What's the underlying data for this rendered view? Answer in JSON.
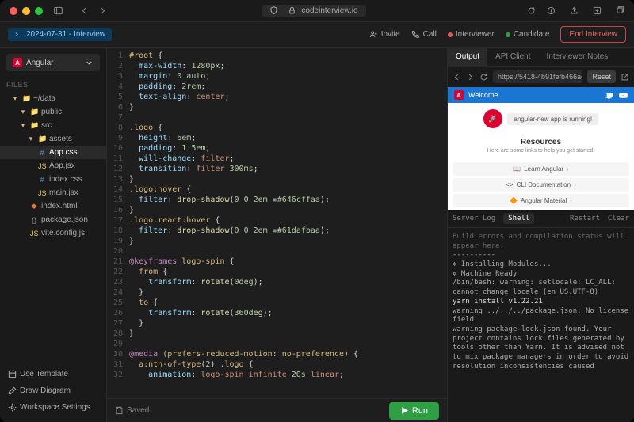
{
  "browser": {
    "url_display": "codeinterview.io"
  },
  "topbar": {
    "tab_label": "2024-07-31 - Interview",
    "invite": "Invite",
    "call": "Call",
    "interviewer": "Interviewer",
    "candidate": "Candidate",
    "end_interview": "End Interview"
  },
  "sidebar": {
    "framework": "Angular",
    "section_files": "FILES",
    "items": [
      {
        "label": "~/data",
        "icon": "folder",
        "level": 1,
        "color": "#dcb67a"
      },
      {
        "label": "public",
        "icon": "folder",
        "level": 2,
        "color": "#dcb67a"
      },
      {
        "label": "src",
        "icon": "folder",
        "level": 2,
        "color": "#dcb67a"
      },
      {
        "label": "assets",
        "icon": "folder",
        "level": 3,
        "color": "#dcb67a"
      },
      {
        "label": "App.css",
        "icon": "css",
        "level": 3,
        "active": true
      },
      {
        "label": "App.jsx",
        "icon": "js",
        "level": 3
      },
      {
        "label": "index.css",
        "icon": "css",
        "level": 3
      },
      {
        "label": "main.jsx",
        "icon": "js",
        "level": 3
      },
      {
        "label": "index.html",
        "icon": "html",
        "level": 2
      },
      {
        "label": "package.json",
        "icon": "json",
        "level": 2
      },
      {
        "label": "vite.config.js",
        "icon": "js",
        "level": 2
      }
    ],
    "use_template": "Use Template",
    "draw_diagram": "Draw Diagram",
    "workspace_settings": "Workspace Settings"
  },
  "editor": {
    "saved": "Saved",
    "run": "Run",
    "lines": [
      [
        {
          "t": "#root",
          "c": "sel"
        },
        {
          "t": " {",
          "c": "punc"
        }
      ],
      [
        {
          "t": "  max-width",
          "c": "prop"
        },
        {
          "t": ": ",
          "c": "punc"
        },
        {
          "t": "1280px",
          "c": "num"
        },
        {
          "t": ";",
          "c": "punc"
        }
      ],
      [
        {
          "t": "  margin",
          "c": "prop"
        },
        {
          "t": ": ",
          "c": "punc"
        },
        {
          "t": "0 auto",
          "c": "num"
        },
        {
          "t": ";",
          "c": "punc"
        }
      ],
      [
        {
          "t": "  padding",
          "c": "prop"
        },
        {
          "t": ": ",
          "c": "punc"
        },
        {
          "t": "2rem",
          "c": "num"
        },
        {
          "t": ";",
          "c": "punc"
        }
      ],
      [
        {
          "t": "  text-align",
          "c": "prop"
        },
        {
          "t": ": ",
          "c": "punc"
        },
        {
          "t": "center",
          "c": "val"
        },
        {
          "t": ";",
          "c": "punc"
        }
      ],
      [
        {
          "t": "}",
          "c": "punc"
        }
      ],
      [],
      [
        {
          "t": ".logo",
          "c": "sel"
        },
        {
          "t": " {",
          "c": "punc"
        }
      ],
      [
        {
          "t": "  height",
          "c": "prop"
        },
        {
          "t": ": ",
          "c": "punc"
        },
        {
          "t": "6em",
          "c": "num"
        },
        {
          "t": ";",
          "c": "punc"
        }
      ],
      [
        {
          "t": "  padding",
          "c": "prop"
        },
        {
          "t": ": ",
          "c": "punc"
        },
        {
          "t": "1.5em",
          "c": "num"
        },
        {
          "t": ";",
          "c": "punc"
        }
      ],
      [
        {
          "t": "  will-change",
          "c": "prop"
        },
        {
          "t": ": ",
          "c": "punc"
        },
        {
          "t": "filter",
          "c": "val"
        },
        {
          "t": ";",
          "c": "punc"
        }
      ],
      [
        {
          "t": "  transition",
          "c": "prop"
        },
        {
          "t": ": ",
          "c": "punc"
        },
        {
          "t": "filter ",
          "c": "val"
        },
        {
          "t": "300ms",
          "c": "num"
        },
        {
          "t": ";",
          "c": "punc"
        }
      ],
      [
        {
          "t": "}",
          "c": "punc"
        }
      ],
      [
        {
          "t": ".logo:hover",
          "c": "sel"
        },
        {
          "t": " {",
          "c": "punc"
        }
      ],
      [
        {
          "t": "  filter",
          "c": "prop"
        },
        {
          "t": ": ",
          "c": "punc"
        },
        {
          "t": "drop-shadow",
          "c": "fn"
        },
        {
          "t": "(",
          "c": "punc"
        },
        {
          "t": "0 0 2em ",
          "c": "num"
        },
        {
          "t": "▪",
          "c": "hex"
        },
        {
          "t": "#646cffaa",
          "c": "num"
        },
        {
          "t": ");",
          "c": "punc"
        }
      ],
      [
        {
          "t": "}",
          "c": "punc"
        }
      ],
      [
        {
          "t": ".logo.react:hover",
          "c": "sel"
        },
        {
          "t": " {",
          "c": "punc"
        }
      ],
      [
        {
          "t": "  filter",
          "c": "prop"
        },
        {
          "t": ": ",
          "c": "punc"
        },
        {
          "t": "drop-shadow",
          "c": "fn"
        },
        {
          "t": "(",
          "c": "punc"
        },
        {
          "t": "0 0 2em ",
          "c": "num"
        },
        {
          "t": "▪",
          "c": "hex"
        },
        {
          "t": "#61dafbaa",
          "c": "num"
        },
        {
          "t": ");",
          "c": "punc"
        }
      ],
      [
        {
          "t": "}",
          "c": "punc"
        }
      ],
      [],
      [
        {
          "t": "@keyframes",
          "c": "kw"
        },
        {
          "t": " logo-spin",
          "c": "sel"
        },
        {
          "t": " {",
          "c": "punc"
        }
      ],
      [
        {
          "t": "  from",
          "c": "sel"
        },
        {
          "t": " {",
          "c": "punc"
        }
      ],
      [
        {
          "t": "    transform",
          "c": "prop"
        },
        {
          "t": ": ",
          "c": "punc"
        },
        {
          "t": "rotate",
          "c": "fn"
        },
        {
          "t": "(",
          "c": "punc"
        },
        {
          "t": "0deg",
          "c": "num"
        },
        {
          "t": ");",
          "c": "punc"
        }
      ],
      [
        {
          "t": "  }",
          "c": "punc"
        }
      ],
      [
        {
          "t": "  to",
          "c": "sel"
        },
        {
          "t": " {",
          "c": "punc"
        }
      ],
      [
        {
          "t": "    transform",
          "c": "prop"
        },
        {
          "t": ": ",
          "c": "punc"
        },
        {
          "t": "rotate",
          "c": "fn"
        },
        {
          "t": "(",
          "c": "punc"
        },
        {
          "t": "360deg",
          "c": "num"
        },
        {
          "t": ");",
          "c": "punc"
        }
      ],
      [
        {
          "t": "  }",
          "c": "punc"
        }
      ],
      [
        {
          "t": "}",
          "c": "punc"
        }
      ],
      [],
      [
        {
          "t": "@media",
          "c": "kw"
        },
        {
          "t": " (prefers-reduced-motion: no-preference)",
          "c": "sel"
        },
        {
          "t": " {",
          "c": "punc"
        }
      ],
      [
        {
          "t": "  a:nth-of-type",
          "c": "sel"
        },
        {
          "t": "(",
          "c": "punc"
        },
        {
          "t": "2",
          "c": "num"
        },
        {
          "t": ") ",
          "c": "punc"
        },
        {
          "t": ".logo",
          "c": "sel"
        },
        {
          "t": " {",
          "c": "punc"
        }
      ],
      [
        {
          "t": "    animation",
          "c": "prop"
        },
        {
          "t": ": ",
          "c": "punc"
        },
        {
          "t": "logo-spin infinite ",
          "c": "val"
        },
        {
          "t": "20s ",
          "c": "num"
        },
        {
          "t": "linear",
          "c": "val"
        },
        {
          "t": ";",
          "c": "punc"
        }
      ]
    ]
  },
  "rpanel": {
    "tabs": [
      "Output",
      "API Client",
      "Interviewer Notes"
    ],
    "url": "https://5418-4b91fefb466ae...",
    "reset": "Reset"
  },
  "preview": {
    "welcome": "Welcome",
    "hero_text": "angular-new app is running!",
    "resources_title": "Resources",
    "resources_sub": "Here are some links to help you get started:",
    "links": [
      "Learn Angular",
      "CLI Documentation",
      "Angular Material"
    ]
  },
  "console": {
    "tabs": [
      "Server Log",
      "Shell"
    ],
    "restart": "Restart",
    "clear": "Clear",
    "lines": [
      "Build errors and compilation status will appear here.",
      "----------",
      "✲ Installing Modules...",
      "✲ Machine Ready",
      "/bin/bash: warning: setlocale: LC_ALL: cannot change locale (en_US.UTF-8)",
      "yarn install v1.22.21",
      "warning ../../../package.json: No license field",
      "warning package-lock.json found. Your project contains lock files generated by tools other than Yarn. It is advised not to mix package managers in order to avoid resolution inconsistencies caused"
    ]
  }
}
